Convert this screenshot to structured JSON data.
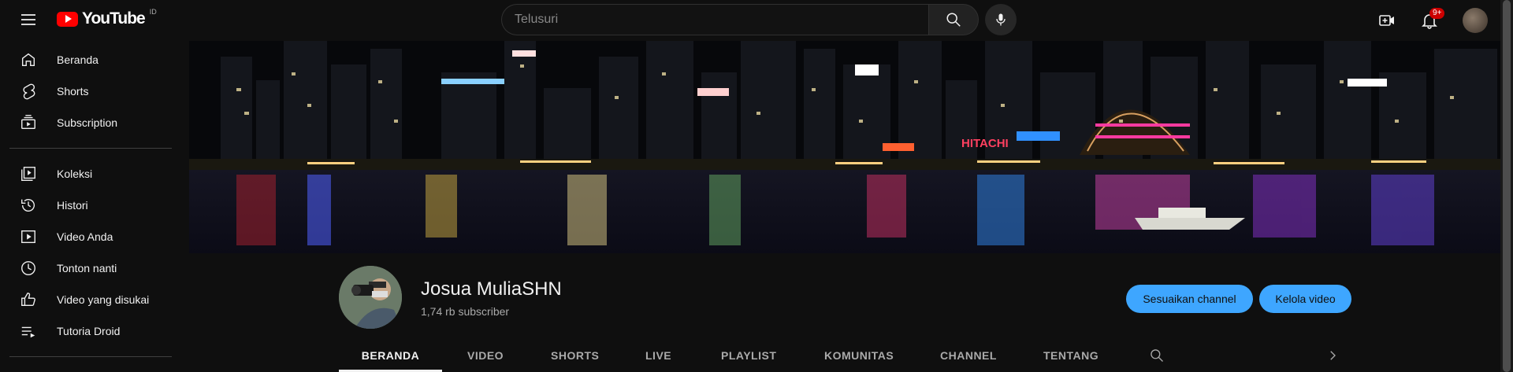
{
  "header": {
    "logo_text": "YouTube",
    "country_code": "ID",
    "search_placeholder": "Telusuri",
    "notification_count": "9+",
    "icons": [
      "menu-icon",
      "youtube-logo",
      "search-icon",
      "mic-icon",
      "create-video-icon",
      "bell-icon",
      "avatar"
    ]
  },
  "sidebar": {
    "items": [
      {
        "label": "Beranda",
        "icon": "home-icon"
      },
      {
        "label": "Shorts",
        "icon": "shorts-icon"
      },
      {
        "label": "Subscription",
        "icon": "subscriptions-icon"
      },
      {
        "label": "Koleksi",
        "icon": "library-icon"
      },
      {
        "label": "Histori",
        "icon": "history-icon"
      },
      {
        "label": "Video Anda",
        "icon": "your-videos-icon"
      },
      {
        "label": "Tonton nanti",
        "icon": "watch-later-icon"
      },
      {
        "label": "Video yang disukai",
        "icon": "liked-icon"
      },
      {
        "label": "Tutoria Droid",
        "icon": "playlist-icon"
      }
    ]
  },
  "channel": {
    "name": "Josua MuliaSHN",
    "subscribers": "1,74 rb subscriber",
    "customize_label": "Sesuaikan channel",
    "manage_label": "Kelola video"
  },
  "tabs": [
    {
      "label": "BERANDA",
      "active": true
    },
    {
      "label": "VIDEO",
      "active": false
    },
    {
      "label": "SHORTS",
      "active": false
    },
    {
      "label": "LIVE",
      "active": false
    },
    {
      "label": "PLAYLIST",
      "active": false
    },
    {
      "label": "KOMUNITAS",
      "active": false
    },
    {
      "label": "CHANNEL",
      "active": false
    },
    {
      "label": "TENTANG",
      "active": false
    }
  ],
  "banner": {
    "sign_text": "HITACHI"
  },
  "colors": {
    "accent_blue": "#3ea6ff",
    "brand_red": "#ff0000",
    "background": "#0f0f0f"
  }
}
